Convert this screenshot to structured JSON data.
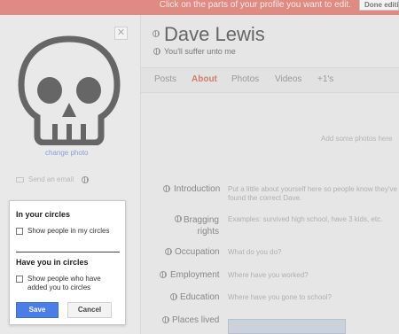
{
  "banner": {
    "message": "Click on the parts of your profile you want to edit.",
    "done_label": "Done editing"
  },
  "profile": {
    "name": "Dave Lewis",
    "tagline": "You'll suffer unto me",
    "change_photo": "change photo",
    "send_email": "Send an email"
  },
  "tabs": [
    {
      "label": "Posts",
      "active": false
    },
    {
      "label": "About",
      "active": true
    },
    {
      "label": "Photos",
      "active": false
    },
    {
      "label": "Videos",
      "active": false
    },
    {
      "label": "+1's",
      "active": false
    }
  ],
  "photos_hint": "Add some photos here",
  "fields": [
    {
      "label": "Introduction",
      "hint": "Put a little about yourself here so people know they've found the correct Dave."
    },
    {
      "label": "Bragging rights",
      "hint": "Examples: survived high school, have 3 kids, etc."
    },
    {
      "label": "Occupation",
      "hint": "What do you do?"
    },
    {
      "label": "Employment",
      "hint": "Where have you worked?"
    },
    {
      "label": "Education",
      "hint": "Where have you gone to school?"
    },
    {
      "label": "Places lived",
      "hint": ""
    }
  ],
  "circles_popup": {
    "in_circles_heading": "In your circles",
    "show_in_circles": "Show people in my circles",
    "have_you_heading": "Have you in circles",
    "show_have_you": "Show people who have added you to circles",
    "save_label": "Save",
    "cancel_label": "Cancel"
  },
  "colors": {
    "banner": "#e08a84",
    "active_tab": "#d27d6a",
    "save_button": "#4a7ee6",
    "link": "#8aa0d6"
  }
}
